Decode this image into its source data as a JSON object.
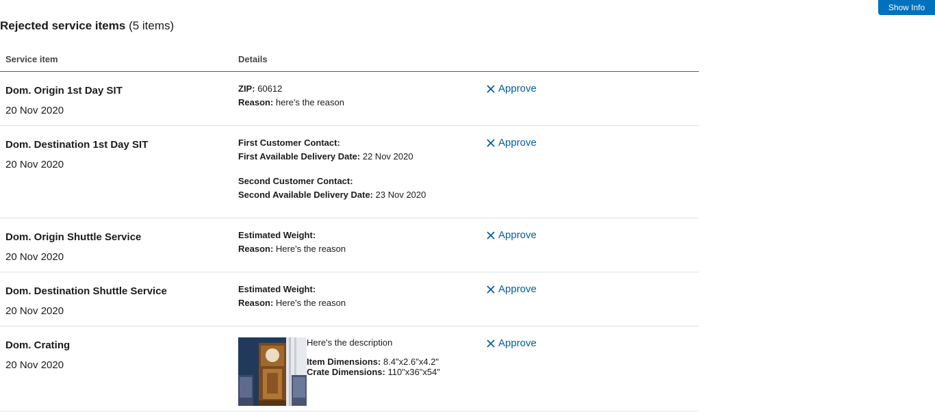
{
  "header": {
    "show_info_label": "Show Info",
    "title": "Rejected service items",
    "count": " (5 items)"
  },
  "table": {
    "col_service": "Service item",
    "col_details": "Details"
  },
  "approve_label": "Approve",
  "colors": {
    "accent": "#005ea2",
    "button": "#0071bc"
  },
  "rows": [
    {
      "name": "Dom. Origin 1st Day SIT",
      "date": "20 Nov 2020",
      "zip_label": "ZIP:",
      "zip_value": "60612",
      "reason_label": "Reason:",
      "reason_value": "here's the reason"
    },
    {
      "name": "Dom. Destination 1st Day SIT",
      "date": "20 Nov 2020",
      "first_contact_label": "First Customer Contact:",
      "first_delivery_label": "First Available Delivery Date:",
      "first_delivery_value": "22 Nov 2020",
      "second_contact_label": "Second Customer Contact:",
      "second_delivery_label": "Second Available Delivery Date:",
      "second_delivery_value": "23 Nov 2020"
    },
    {
      "name": "Dom. Origin Shuttle Service",
      "date": "20 Nov 2020",
      "weight_label": "Estimated Weight:",
      "reason_label": "Reason:",
      "reason_value": "Here's the reason"
    },
    {
      "name": "Dom. Destination Shuttle Service",
      "date": "20 Nov 2020",
      "weight_label": "Estimated Weight:",
      "reason_label": "Reason:",
      "reason_value": "Here's the reason"
    },
    {
      "name": "Dom. Crating",
      "date": "20 Nov 2020",
      "description": "Here's the description",
      "item_dim_label": "Item Dimensions:",
      "item_dim_value": "8.4\"x2.6\"x4.2\"",
      "crate_dim_label": "Crate Dimensions:",
      "crate_dim_value": "110\"x36\"x54\""
    }
  ]
}
